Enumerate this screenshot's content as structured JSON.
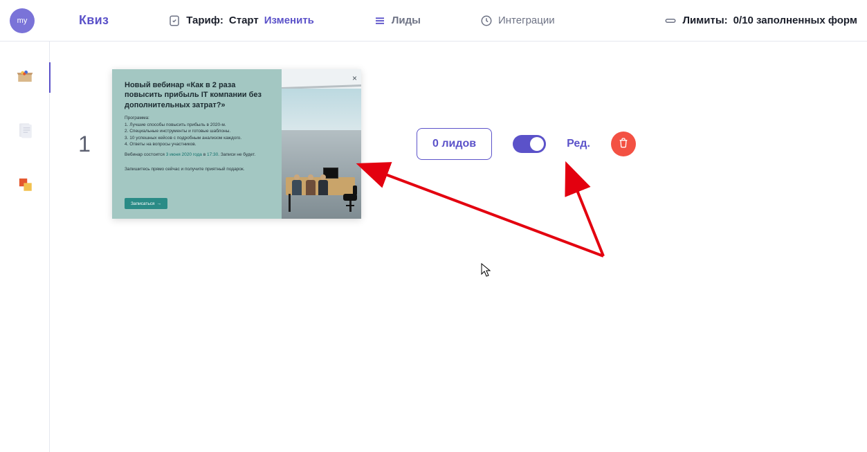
{
  "header": {
    "avatar_text": "my",
    "brand": "Квиз",
    "tariff_label": "Тариф:",
    "tariff_value": "Старт",
    "tariff_change": "Изменить",
    "leads_label": "Лиды",
    "integrations_label": "Интеграции",
    "limits_label": "Лимиты:",
    "limits_value": "0/10 заполненных форм"
  },
  "sidebar": {
    "items": [
      {
        "name": "quizzes",
        "active": true
      },
      {
        "name": "templates",
        "active": false
      },
      {
        "name": "apps",
        "active": false
      }
    ]
  },
  "row": {
    "number": "1",
    "leads_button": "0 лидов",
    "toggle_on": true,
    "edit_label": "Ред."
  },
  "card": {
    "title": "Новый вебинар «Как в 2 раза повысить прибыль IT компании без дополнительных затрат?»",
    "program_label": "Программа:",
    "program_items": [
      "1. Лучшие способы повысить прибыль в 2020-м.",
      "2. Специальные инструменты и готовые шаблоны.",
      "3. 10 успешных кейсов с подробным анализом каждого.",
      "4. Ответы на вопросы участников."
    ],
    "schedule_prefix": "Вебинар состоится ",
    "schedule_date": "3 июня 2020 года",
    "schedule_mid": " в ",
    "schedule_time": "17:30",
    "schedule_suffix": ". Записи не будет.",
    "note": "Запишитесь прямо сейчас и получите приятный подарок.",
    "cta_label": "Записаться"
  }
}
